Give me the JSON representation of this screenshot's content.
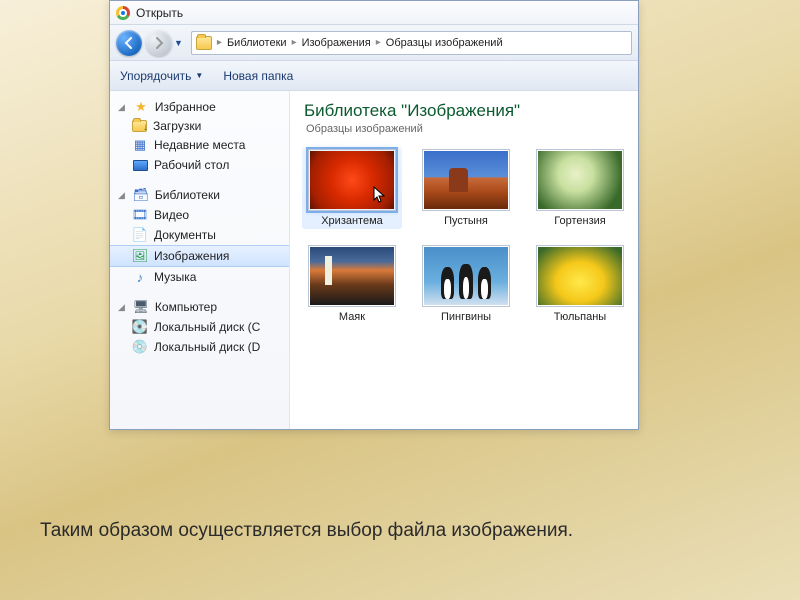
{
  "titlebar": {
    "title": "Открыть"
  },
  "breadcrumb": {
    "seg1": "Библиотеки",
    "seg2": "Изображения",
    "seg3": "Образцы изображений"
  },
  "toolbar": {
    "organize": "Упорядочить",
    "new_folder": "Новая папка"
  },
  "sidebar": {
    "favorites": {
      "header": "Избранное",
      "downloads": "Загрузки",
      "recent": "Недавние места",
      "desktop": "Рабочий стол"
    },
    "libraries": {
      "header": "Библиотеки",
      "video": "Видео",
      "documents": "Документы",
      "images": "Изображения",
      "music": "Музыка"
    },
    "computer": {
      "header": "Компьютер",
      "drive_c": "Локальный диск (C",
      "drive_d": "Локальный диск (D"
    }
  },
  "main": {
    "title": "Библиотека \"Изображения\"",
    "subtitle": "Образцы изображений"
  },
  "thumbs": {
    "chrysanthemum": "Хризантема",
    "desert": "Пустыня",
    "hydrangea": "Гортензия",
    "lighthouse": "Маяк",
    "penguins": "Пингвины",
    "tulips": "Тюльпаны"
  },
  "caption": "Таким образом осуществляется выбор файла изображения."
}
